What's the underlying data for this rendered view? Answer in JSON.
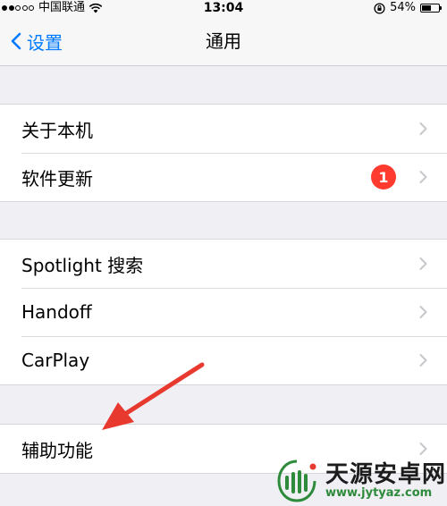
{
  "status_bar": {
    "carrier": "中国联通",
    "time": "13:04",
    "battery_percent_label": "54%",
    "battery_level": 0.54
  },
  "nav": {
    "back_label": "设置",
    "title": "通用"
  },
  "groups": [
    {
      "items": [
        {
          "label": "关于本机"
        },
        {
          "label": "软件更新",
          "badge": "1"
        }
      ]
    },
    {
      "items": [
        {
          "label": "Spotlight 搜索"
        },
        {
          "label": "Handoff"
        },
        {
          "label": "CarPlay"
        }
      ]
    },
    {
      "items": [
        {
          "label": "辅助功能"
        }
      ]
    }
  ],
  "watermark": {
    "title": "天源安卓网",
    "url": "www.jytyaz.com"
  },
  "colors": {
    "accent": "#007aff",
    "badge": "#ff3b30",
    "annotation": "#e8392f",
    "watermark_green": "#2e8b3b"
  }
}
